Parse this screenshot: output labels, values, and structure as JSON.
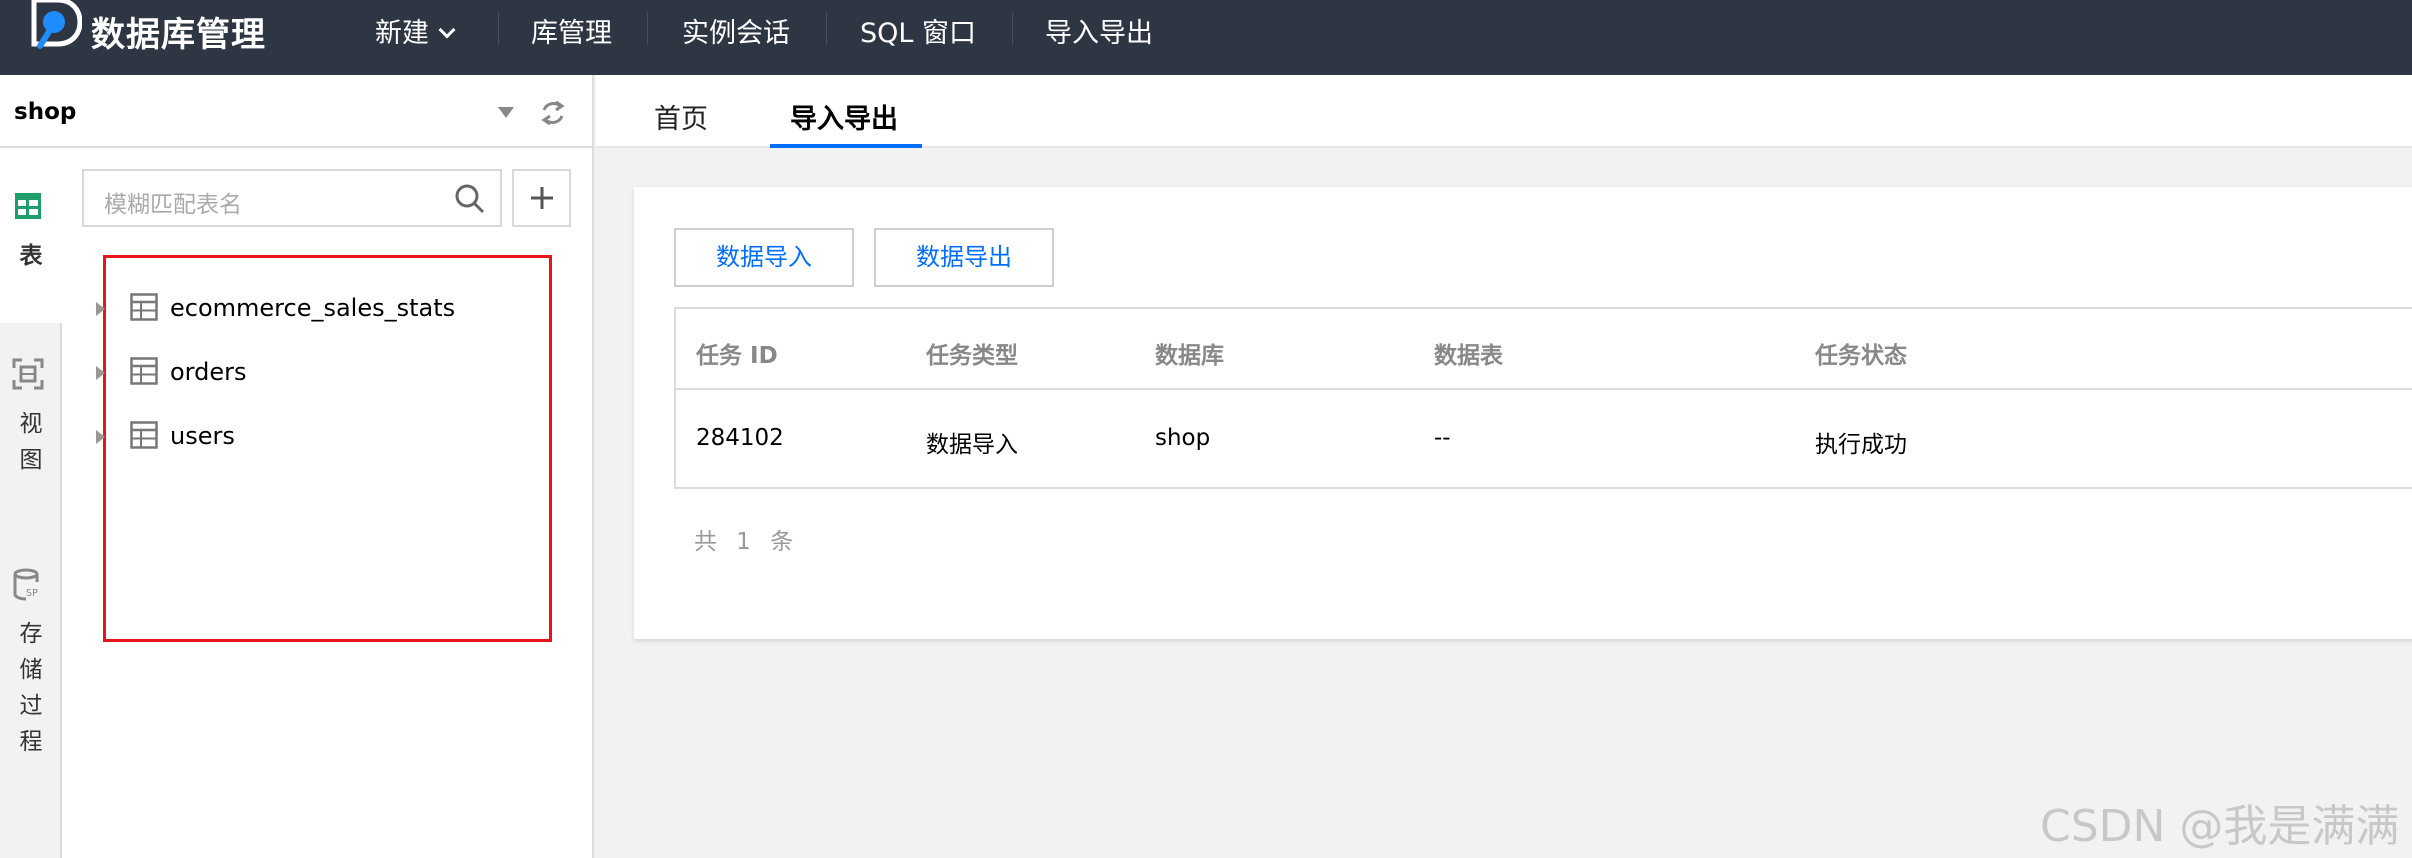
{
  "topbar": {
    "brand": "数据库管理",
    "nav": [
      {
        "label": "新建"
      },
      {
        "label": "库管理"
      },
      {
        "label": "实例会话"
      },
      {
        "label": "SQL 窗口"
      },
      {
        "label": "导入导出"
      }
    ]
  },
  "sidebar": {
    "database": "shop",
    "tabs": [
      {
        "label": "表",
        "icon": "table-icon",
        "active": true
      },
      {
        "label": "视图",
        "icon": "view-icon"
      },
      {
        "label": "存储过程",
        "icon": "stored-procedure-icon"
      }
    ],
    "search": {
      "placeholder": "模糊匹配表名"
    },
    "tables": [
      {
        "name": "ecommerce_sales_stats"
      },
      {
        "name": "orders"
      },
      {
        "name": "users"
      }
    ]
  },
  "main": {
    "tabs": [
      {
        "label": "首页",
        "active": false
      },
      {
        "label": "导入导出",
        "active": true
      }
    ],
    "buttons": {
      "import": "数据导入",
      "export": "数据导出"
    },
    "table": {
      "columns": [
        "任务 ID",
        "任务类型",
        "数据库",
        "数据表",
        "任务状态"
      ],
      "rows": [
        [
          "284102",
          "数据导入",
          "shop",
          "--",
          "执行成功"
        ]
      ]
    },
    "total": "共 1 条"
  },
  "watermark": "CSDN @我是满满",
  "colors": {
    "topbar": "#2e3543",
    "accent": "#006eff",
    "highlight": "#e8141b",
    "sidebar_active_icon": "#1e9e6a"
  }
}
